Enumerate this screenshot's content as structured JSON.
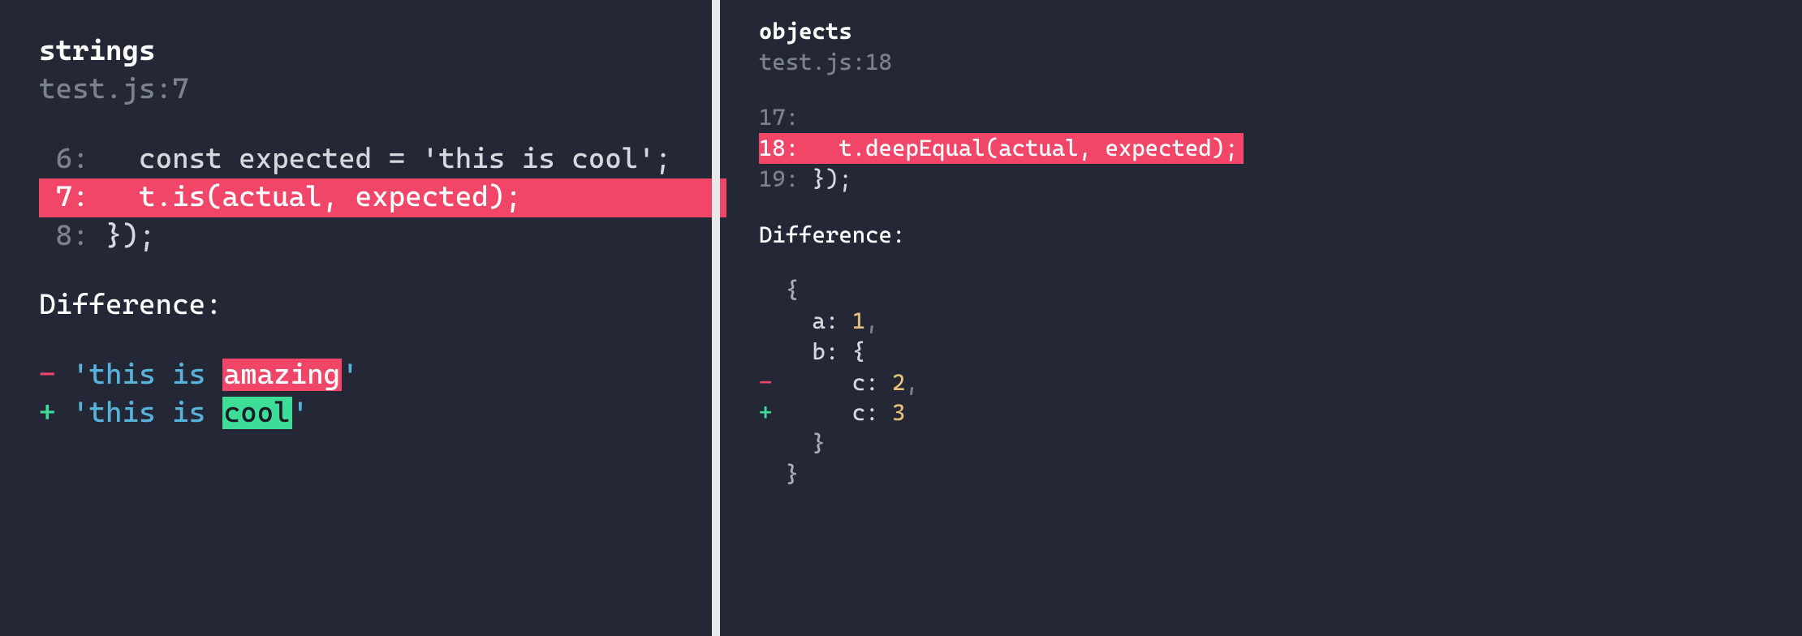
{
  "left": {
    "title": "strings",
    "location": "test.js:7",
    "code": {
      "rows": [
        {
          "n": " 6:",
          "text": "   const expected = 'this is cool';",
          "hl": false
        },
        {
          "n": " 7:",
          "text": "   t.is(actual, expected);",
          "hl": true
        },
        {
          "n": " 8:",
          "text": " });",
          "hl": false
        }
      ]
    },
    "difference_label": "Difference:",
    "diff": {
      "minus_sign": "-",
      "plus_sign": "+",
      "prefix": "'this is ",
      "removed": "amazing",
      "added": "cool",
      "suffix": "'"
    }
  },
  "right": {
    "title": "objects",
    "location": "test.js:18",
    "code": {
      "rows": [
        {
          "n": "17:",
          "text": "",
          "hl": false
        },
        {
          "n": "18:",
          "text": "   t.deepEqual(actual, expected);",
          "hl": true
        },
        {
          "n": "19:",
          "text": " });",
          "hl": false
        }
      ]
    },
    "difference_label": "Difference:",
    "obj": {
      "open": "  {",
      "line_a": {
        "pre": "    a: ",
        "val": "1",
        "post": ","
      },
      "line_b": {
        "pre": "    b: {"
      },
      "line_c_r": {
        "sign": "-",
        "pre": "      c: ",
        "val": "2",
        "post": ","
      },
      "line_c_a": {
        "sign": "+",
        "pre": "      c: ",
        "val": "3"
      },
      "close_b": "    }",
      "close_a": "  }"
    }
  }
}
